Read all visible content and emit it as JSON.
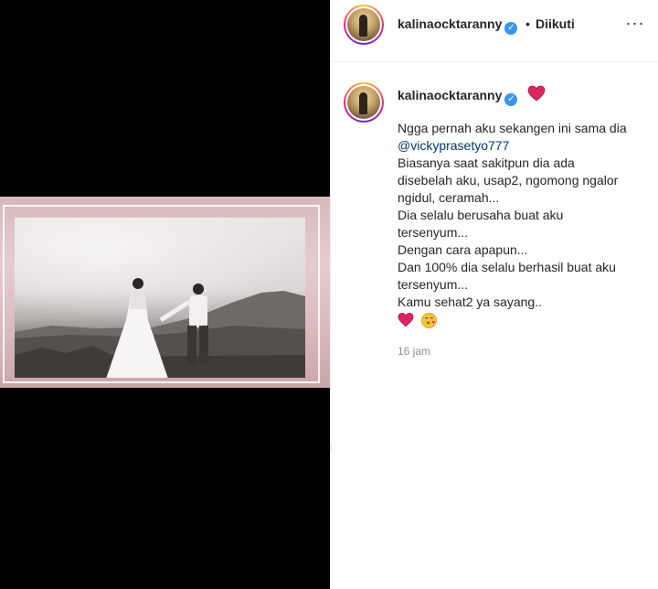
{
  "header": {
    "username": "kalinaocktaranny",
    "separator": "•",
    "follow_status": "Diikuti",
    "more_label": "···"
  },
  "caption": {
    "username": "kalinaocktaranny",
    "lines_before_mention": "Ngga pernah aku sekangen ini sama dia",
    "mention": "@vickyprasetyo777",
    "lines_after_mention": "Biasanya saat sakitpun dia ada\ndisebelah aku, usap2, ngomong ngalor\nngidul, ceramah...\nDia selalu berusaha buat aku\ntersenyum...\nDengan cara apapun...\nDan 100% dia selalu berhasil buat aku\ntersenyum...\nKamu sehat2 ya sayang..",
    "timestamp": "16 jam"
  },
  "icons": {
    "verified": "verified-badge-icon",
    "heart": "red-heart-emoji",
    "kiss": "face-blowing-kiss-emoji"
  },
  "colors": {
    "verified_blue": "#3897f0",
    "mention_blue": "#00376b",
    "heart_red": "#e0245e"
  }
}
